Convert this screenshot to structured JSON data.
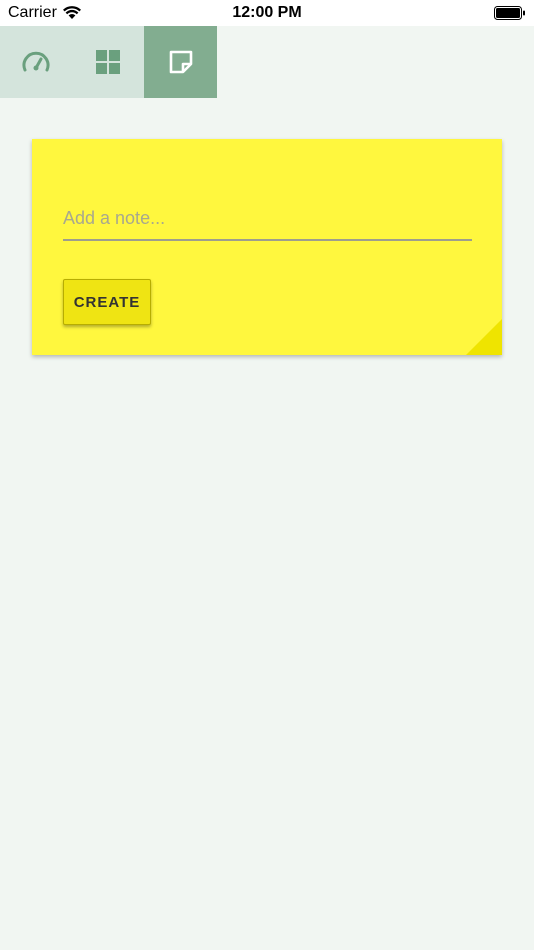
{
  "status_bar": {
    "carrier": "Carrier",
    "time": "12:00 PM",
    "wifi_icon": "wifi-icon",
    "battery_icon": "battery-icon"
  },
  "tabs": [
    {
      "icon": "speedometer-icon",
      "active": false
    },
    {
      "icon": "grid-icon",
      "active": false
    },
    {
      "icon": "sticky-note-icon",
      "active": true
    }
  ],
  "note": {
    "placeholder": "Add a note...",
    "value": "",
    "create_label": "CREATE"
  },
  "colors": {
    "background": "#f1f6f2",
    "tabbar": "#d4e4dc",
    "tab_active": "#82ad90",
    "tab_icon": "#6aa07e",
    "note_yellow": "#fff73e",
    "button_yellow": "#efe413"
  }
}
